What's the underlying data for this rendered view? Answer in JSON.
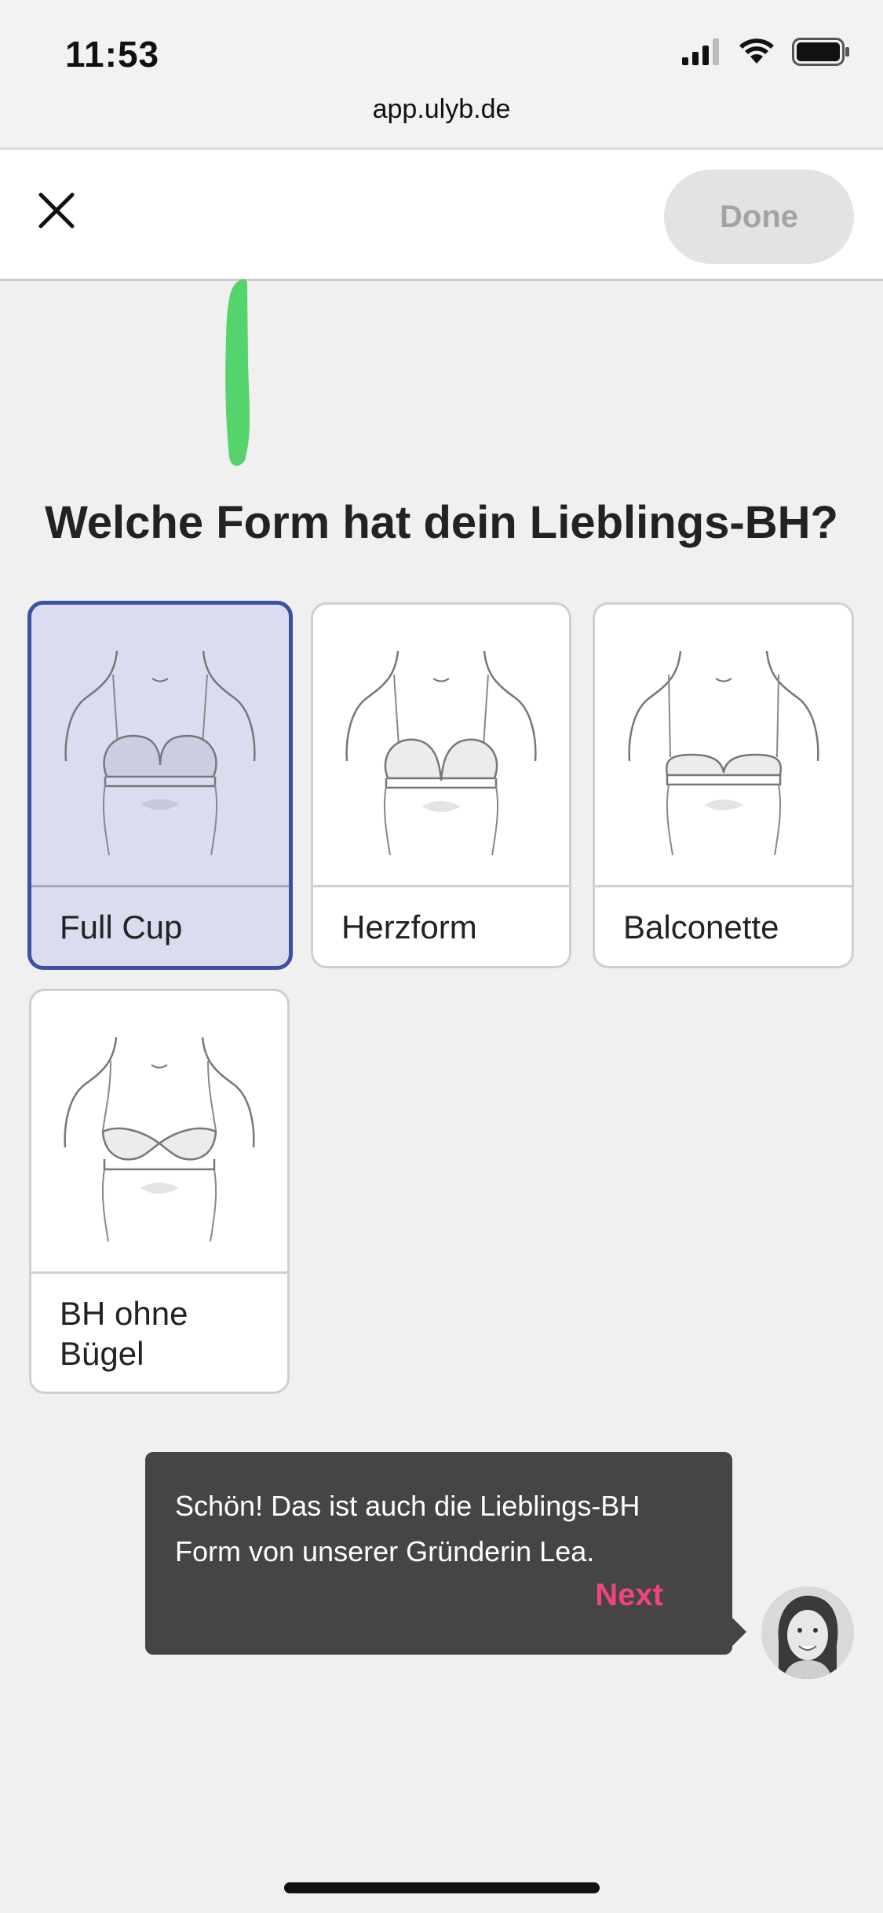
{
  "status_bar": {
    "time": "11:53",
    "url": "app.ulyb.de"
  },
  "toolbar": {
    "done_label": "Done"
  },
  "question": "Welche Form hat dein Lieblings-BH?",
  "options": [
    {
      "label": "Full Cup",
      "selected": true
    },
    {
      "label": "Herzform",
      "selected": false
    },
    {
      "label": "Balconette",
      "selected": false
    },
    {
      "label": "BH ohne Bügel",
      "selected": false
    }
  ],
  "tooltip": {
    "text": "Schön! Das ist auch die Lieblings-BH Form von unserer Gründerin Lea.",
    "next_label": "Next"
  },
  "colors": {
    "accent_selected_border": "#3e4fa6",
    "selected_background": "#dcdcf0",
    "next_link": "#f0447a",
    "progress_mark": "#55d36d",
    "tooltip_background": "#454545"
  },
  "icons": [
    "signal-icon",
    "wifi-icon",
    "battery-icon",
    "close-icon",
    "bra-illustration-icon",
    "avatar"
  ]
}
